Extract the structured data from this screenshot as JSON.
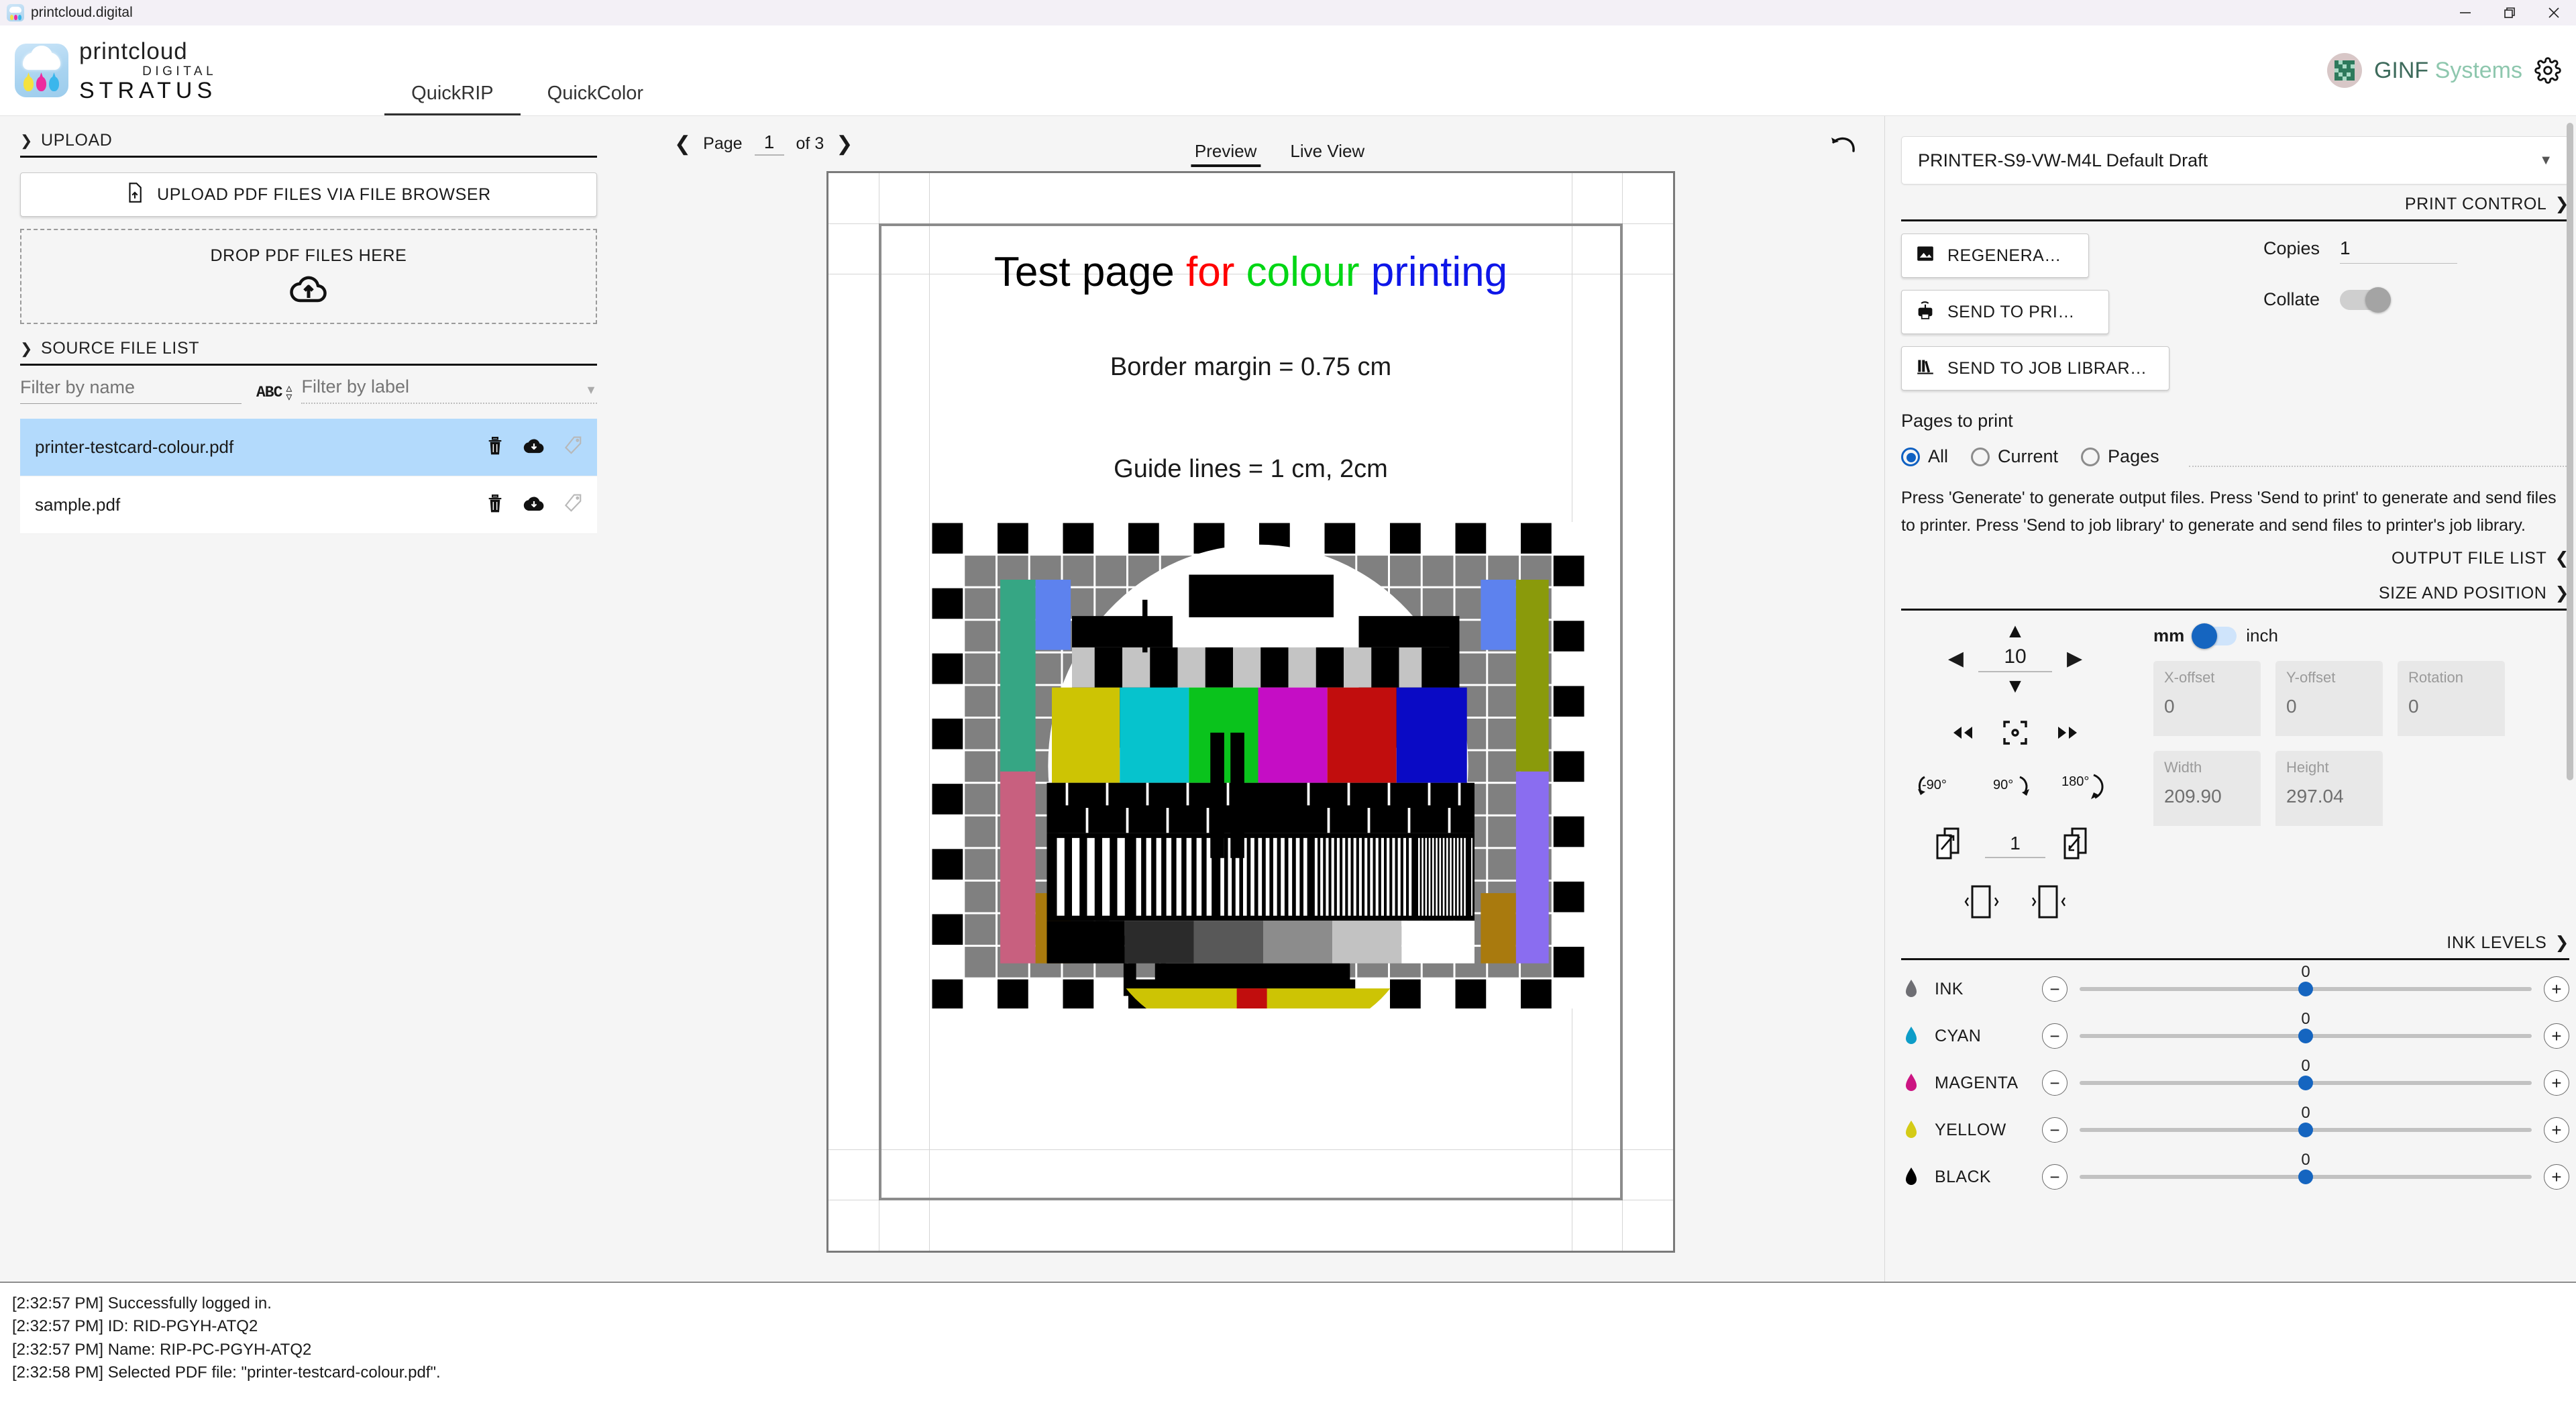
{
  "window": {
    "title": "printcloud.digital",
    "minimize_label": "Minimize",
    "restore_label": "Restore",
    "close_label": "Close"
  },
  "brand": {
    "line1": "printcloud",
    "line2": "DIGITAL",
    "line3": "STRATUS"
  },
  "nav": {
    "tabs": [
      {
        "label": "QuickRIP",
        "active": true
      },
      {
        "label": "QuickColor",
        "active": false
      }
    ]
  },
  "user": {
    "name_bold": "GINF",
    "name_light": "Systems"
  },
  "upload": {
    "section_title": "UPLOAD",
    "browse_button": "UPLOAD PDF FILES VIA FILE BROWSER",
    "drop_text": "DROP PDF FILES HERE"
  },
  "source_file_list": {
    "section_title": "SOURCE FILE LIST",
    "filter_name_placeholder": "Filter by name",
    "filter_name_value": "",
    "sort_icon_label": "ABC",
    "filter_label_placeholder": "Filter by label",
    "filter_label_value": "",
    "files": [
      {
        "name": "printer-testcard-colour.pdf",
        "selected": true
      },
      {
        "name": "sample.pdf",
        "selected": false
      }
    ]
  },
  "preview": {
    "page_word": "Page",
    "page_number": "1",
    "page_of": "of 3",
    "prev_label": "Previous page",
    "next_label": "Next page",
    "tabs": [
      {
        "label": "Preview",
        "active": true
      },
      {
        "label": "Live View",
        "active": false
      }
    ],
    "undo_label": "Undo",
    "document": {
      "title_parts": [
        {
          "text": "Test page",
          "color": "#000000"
        },
        {
          "text": "for",
          "color": "#ff0000"
        },
        {
          "text": "colour",
          "color": "#00d614"
        },
        {
          "text": "printing",
          "color": "#0e16e8"
        }
      ],
      "line1": "Border margin = 0.75 cm",
      "line2": "Guide lines = 1 cm, 2cm"
    }
  },
  "right_panel": {
    "printer_selected": "PRINTER-S9-VW-M4L Default Draft",
    "print_control": {
      "section_title": "PRINT CONTROL",
      "regenerate_button": "REGENERA…",
      "send_to_printer_button": "SEND TO PRI…",
      "send_to_job_library_button": "SEND TO JOB LIBRAR…",
      "copies_label": "Copies",
      "copies_value": "1",
      "collate_label": "Collate",
      "collate_on": false,
      "pages_to_print_label": "Pages to print",
      "radio_all": "All",
      "radio_current": "Current",
      "radio_pages": "Pages",
      "radio_selected": "All",
      "pages_value": "",
      "help_text": "Press 'Generate' to generate output files. Press 'Send to print' to generate and send files to printer. Press 'Send to job library' to generate and send files to printer's job library."
    },
    "output_file_list": {
      "section_title": "OUTPUT FILE LIST"
    },
    "size_and_position": {
      "section_title": "SIZE AND POSITION",
      "step_value": "10",
      "unit_mm": "mm",
      "unit_inch": "inch",
      "unit_selected": "mm",
      "rotate_ccw": "-90°",
      "rotate_cw": "90°",
      "rotate_180": "180°",
      "nup_value": "1",
      "fields": [
        {
          "label": "X-offset",
          "value": "0"
        },
        {
          "label": "Y-offset",
          "value": "0"
        },
        {
          "label": "Rotation",
          "value": "0"
        },
        {
          "label": "Width",
          "value": "209.90"
        },
        {
          "label": "Height",
          "value": "297.04"
        }
      ]
    },
    "ink_levels": {
      "section_title": "INK LEVELS",
      "rows": [
        {
          "name": "INK",
          "color": "#6e6e73",
          "value": "0"
        },
        {
          "name": "CYAN",
          "color": "#0d9dc8",
          "value": "0"
        },
        {
          "name": "MAGENTA",
          "color": "#cc1482",
          "value": "0"
        },
        {
          "name": "YELLOW",
          "color": "#d4cb16",
          "value": "0"
        },
        {
          "name": "BLACK",
          "color": "#000000",
          "value": "0"
        }
      ]
    }
  },
  "log": {
    "lines": [
      "[2:32:57 PM] Successfully logged in.",
      "[2:32:57 PM] ID: RID-PGYH-ATQ2",
      "[2:32:57 PM] Name: RIP-PC-PGYH-ATQ2",
      "[2:32:58 PM] Selected PDF file: \"printer-testcard-colour.pdf\"."
    ]
  }
}
